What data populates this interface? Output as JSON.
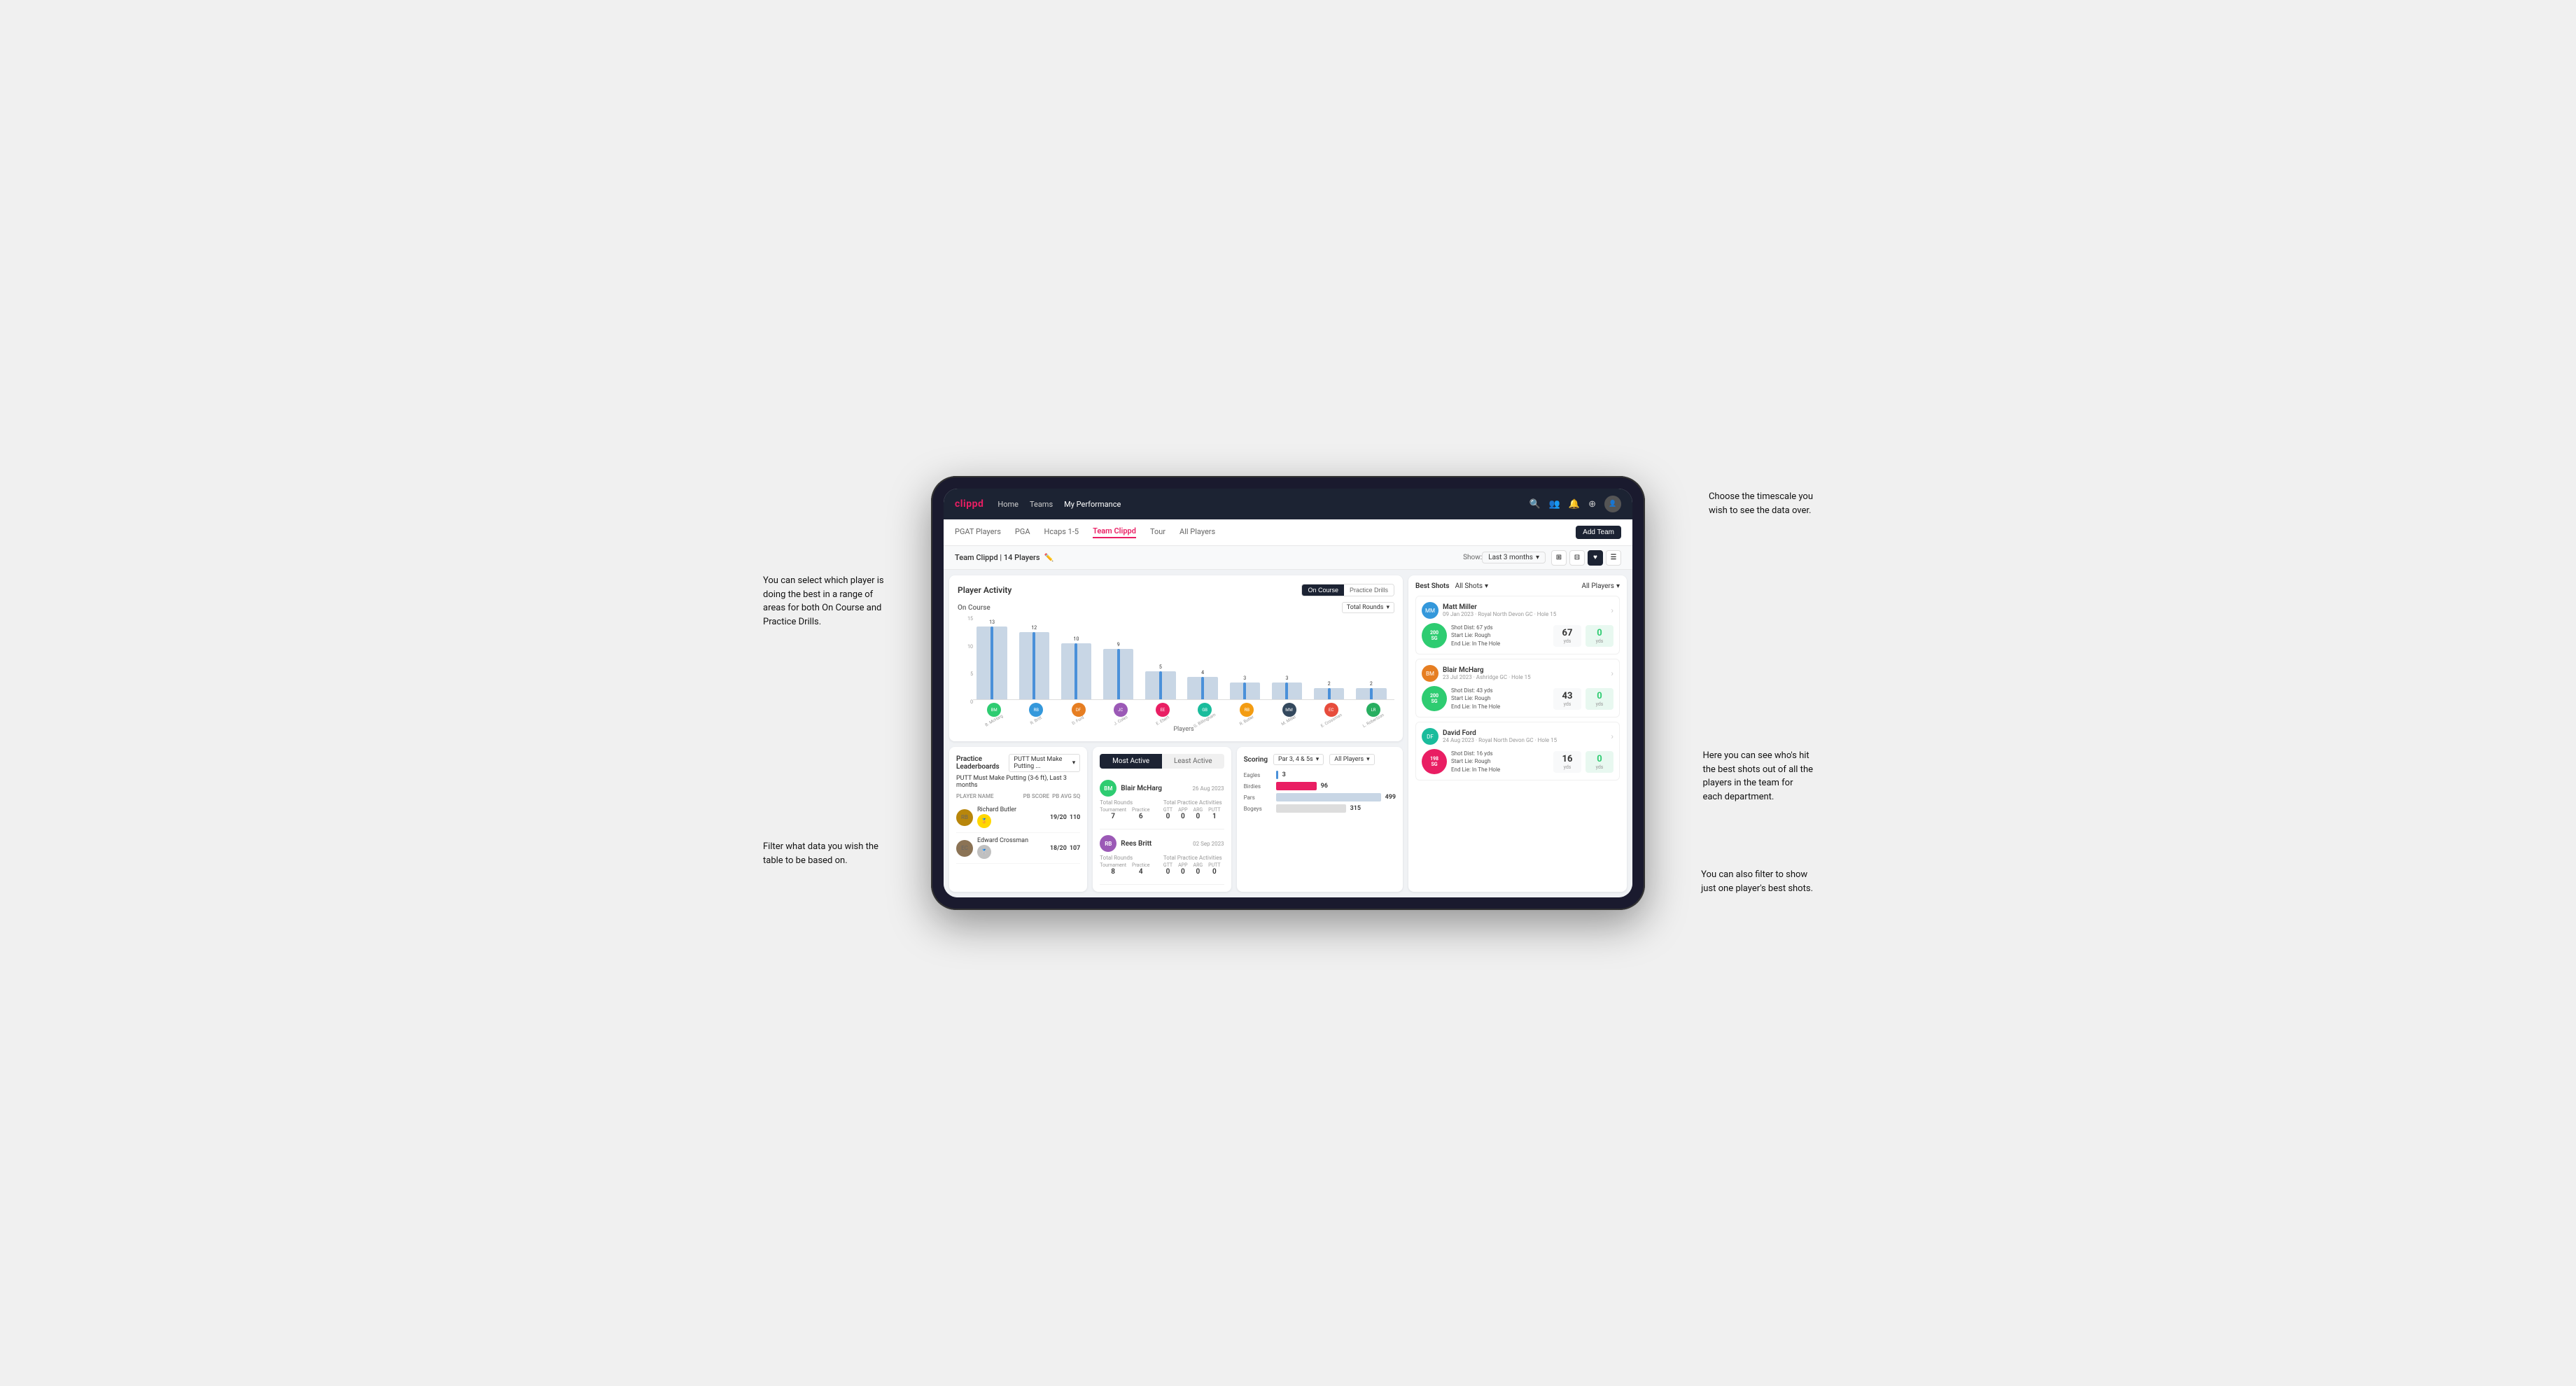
{
  "annotations": {
    "top_right": "Choose the timescale you\nwish to see the data over.",
    "left_top": "You can select which player is\ndoing the best in a range of\nareas for both On Course and\nPractice Drills.",
    "left_bottom": "Filter what data you wish the\ntable to be based on.",
    "right_middle": "Here you can see who's hit\nthe best shots out of all the\nplayers in the team for\neach department.",
    "right_bottom": "You can also filter to show\njust one player's best shots."
  },
  "nav": {
    "logo": "clippd",
    "links": [
      "Home",
      "Teams",
      "My Performance"
    ],
    "icons": [
      "search",
      "people",
      "bell",
      "add",
      "avatar"
    ]
  },
  "sub_nav": {
    "tabs": [
      "PGAT Players",
      "PGA",
      "Hcaps 1-5",
      "Team Clippd",
      "Tour",
      "All Players"
    ],
    "active_tab": "Team Clippd",
    "add_button": "Add Team"
  },
  "team_header": {
    "name": "Team Clippd | 14 Players",
    "show_label": "Show:",
    "show_value": "Last 3 months",
    "view_options": [
      "grid-2",
      "grid-4",
      "heart",
      "list"
    ]
  },
  "player_activity": {
    "title": "Player Activity",
    "toggle_options": [
      "On Course",
      "Practice Drills"
    ],
    "active_toggle": "On Course",
    "section_title": "On Course",
    "chart_dropdown": "Total Rounds",
    "bars": [
      {
        "name": "B. McHarg",
        "value": 13,
        "height_pct": 87
      },
      {
        "name": "R. Britt",
        "value": 12,
        "height_pct": 80
      },
      {
        "name": "D. Ford",
        "value": 10,
        "height_pct": 67
      },
      {
        "name": "J. Coles",
        "value": 9,
        "height_pct": 60
      },
      {
        "name": "E. Ebert",
        "value": 5,
        "height_pct": 33
      },
      {
        "name": "G. Billingham",
        "value": 4,
        "height_pct": 27
      },
      {
        "name": "R. Butler",
        "value": 3,
        "height_pct": 20
      },
      {
        "name": "M. Miller",
        "value": 3,
        "height_pct": 20
      },
      {
        "name": "E. Crossman",
        "value": 2,
        "height_pct": 13
      },
      {
        "name": "L. Robertson",
        "value": 2,
        "height_pct": 13
      }
    ],
    "y_labels": [
      "15",
      "10",
      "5",
      "0"
    ],
    "x_title": "Players",
    "y_title": "Total Rounds"
  },
  "best_shots": {
    "title": "Best Shots",
    "tab_all": "All Shots",
    "dropdown_chevron": "▾",
    "all_players_label": "All Players",
    "players": [
      {
        "name": "Matt Miller",
        "date": "09 Jan 2023",
        "course": "Royal North Devon GC",
        "hole": "Hole 15",
        "badge_text": "200\nSG",
        "badge_color": "green",
        "shot_dist": "Shot Dist: 67 yds",
        "start_lie": "Start Lie: Rough",
        "end_lie": "End Lie: In The Hole",
        "stat1_value": "67",
        "stat1_unit": "yds",
        "stat2_value": "0",
        "stat2_unit": "yds"
      },
      {
        "name": "Blair McHarg",
        "date": "23 Jul 2023",
        "course": "Ashridge GC",
        "hole": "Hole 15",
        "badge_text": "200\nSG",
        "badge_color": "green",
        "shot_dist": "Shot Dist: 43 yds",
        "start_lie": "Start Lie: Rough",
        "end_lie": "End Lie: In The Hole",
        "stat1_value": "43",
        "stat1_unit": "yds",
        "stat2_value": "0",
        "stat2_unit": "yds"
      },
      {
        "name": "David Ford",
        "date": "24 Aug 2023",
        "course": "Royal North Devon GC",
        "hole": "Hole 15",
        "badge_text": "198\nSG",
        "badge_color": "pink",
        "shot_dist": "Shot Dist: 16 yds",
        "start_lie": "Start Lie: Rough",
        "end_lie": "End Lie: In The Hole",
        "stat1_value": "16",
        "stat1_unit": "yds",
        "stat2_value": "0",
        "stat2_unit": "yds"
      }
    ]
  },
  "practice_leaderboards": {
    "title": "Practice Leaderboards",
    "dropdown": "PUTT Must Make Putting ...",
    "subtitle": "PUTT Must Make Putting (3-6 ft), Last 3 months",
    "cols": [
      "PLAYER NAME",
      "PB SCORE",
      "PB AVG SQ"
    ],
    "players": [
      {
        "rank": 1,
        "name": "Richard Butler",
        "score": "19/20",
        "avg": "110"
      },
      {
        "rank": 2,
        "name": "Edward Crossman",
        "score": "18/20",
        "avg": "107"
      }
    ]
  },
  "most_active": {
    "tabs": [
      "Most Active",
      "Least Active"
    ],
    "active_tab": "Most Active",
    "entries": [
      {
        "name": "Blair McHarg",
        "date": "26 Aug 2023",
        "total_rounds_label": "Total Rounds",
        "tournament": "7",
        "practice": "6",
        "total_practice_label": "Total Practice Activities",
        "gtt": "0",
        "app": "0",
        "arg": "0",
        "putt": "1"
      },
      {
        "name": "Rees Britt",
        "date": "02 Sep 2023",
        "total_rounds_label": "Total Rounds",
        "tournament": "8",
        "practice": "4",
        "total_practice_label": "Total Practice Activities",
        "gtt": "0",
        "app": "0",
        "arg": "0",
        "putt": "0"
      }
    ]
  },
  "scoring": {
    "title": "Scoring",
    "par_label": "Par 3, 4 & 5s",
    "all_players": "All Players",
    "bars": [
      {
        "label": "Eagles",
        "value": 3,
        "max": 500,
        "color": "#4a90d9"
      },
      {
        "label": "Birdies",
        "value": 96,
        "max": 500,
        "color": "#e91e63"
      },
      {
        "label": "Pars",
        "value": 499,
        "max": 500,
        "color": "#ccc"
      },
      {
        "label": "Bogeys",
        "value": 315,
        "max": 500,
        "color": "#ccc"
      }
    ]
  }
}
